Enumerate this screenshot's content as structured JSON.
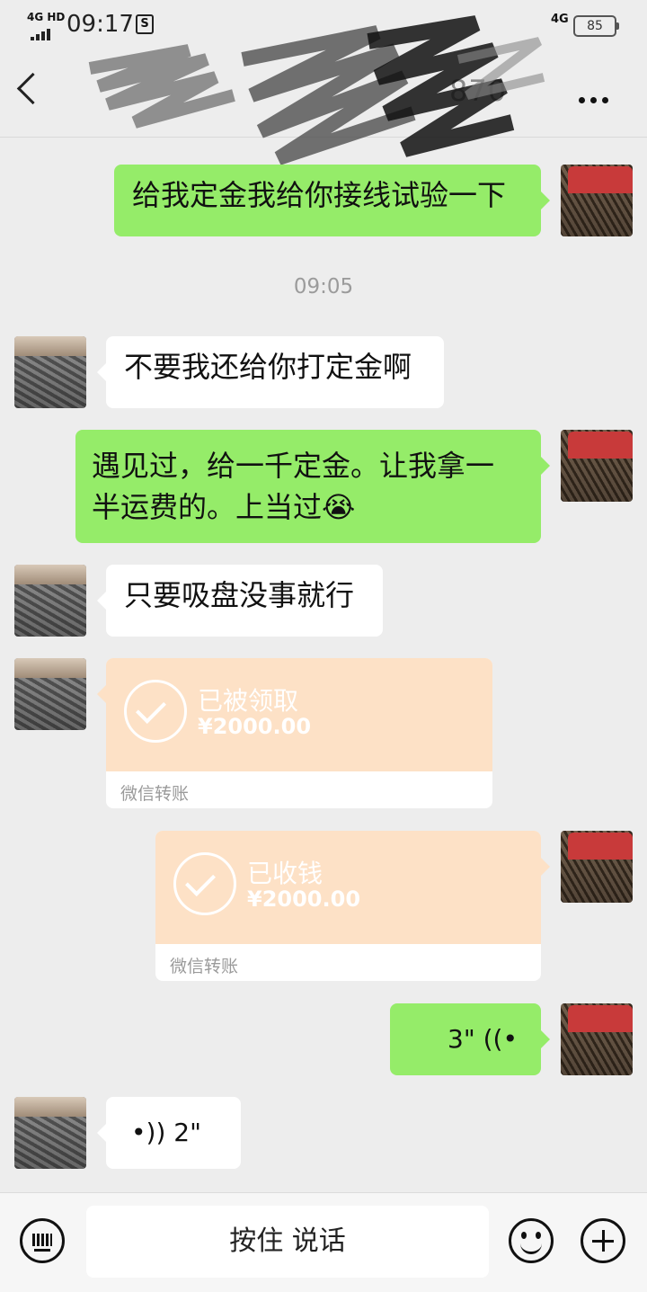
{
  "status_bar": {
    "network_left": "4G HD",
    "time": "09:17",
    "s_icon": "S",
    "network_right": "4G",
    "battery": "85"
  },
  "header": {
    "title_partial": "870"
  },
  "messages": {
    "m1": "给我定金我给你接线试验一下",
    "timestamp": "09:05",
    "m2": "不要我还给你打定金啊",
    "m3_line1": "遇见过，给一千定金。让我拿一",
    "m3_line2": "半运费的。上当过",
    "m3_emoji": "😭",
    "m4": "只要吸盘没事就行",
    "transfer1": {
      "status": "已被领取",
      "amount": "¥2000.00",
      "footer": "微信转账"
    },
    "transfer2": {
      "status": "已收钱",
      "amount": "¥2000.00",
      "footer": "微信转账"
    },
    "voice_me": "3\"",
    "voice_them": "2\""
  },
  "bottom_bar": {
    "hold_to_talk": "按住 说话"
  },
  "colors": {
    "bg": "#ededed",
    "my_bubble": "#95ec69",
    "their_bubble": "#ffffff",
    "transfer": "#fde1c6"
  }
}
